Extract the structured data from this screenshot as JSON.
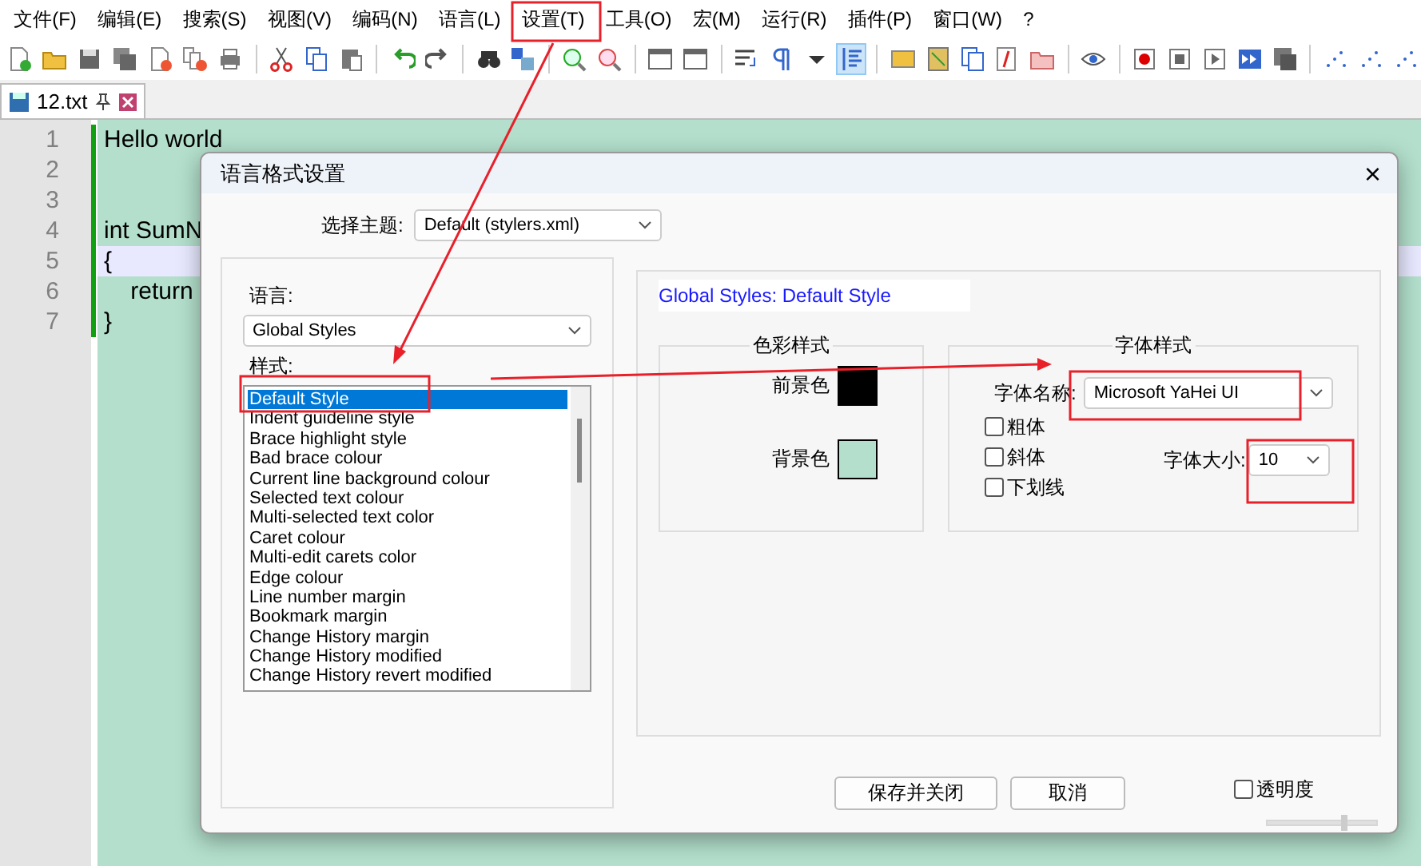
{
  "menu": [
    "文件(F)",
    "编辑(E)",
    "搜索(S)",
    "视图(V)",
    "编码(N)",
    "语言(L)",
    "设置(T)",
    "工具(O)",
    "宏(M)",
    "运行(R)",
    "插件(P)",
    "窗口(W)",
    "?"
  ],
  "tabs": [
    {
      "label": "12.txt",
      "selected": true
    }
  ],
  "editor": {
    "lines": [
      {
        "number": "1",
        "text": "Hello world",
        "current": false
      },
      {
        "number": "2",
        "current": false
      },
      {
        "number": "3",
        "current": false
      },
      {
        "number": "4",
        "text": "int SumN",
        "current": false
      },
      {
        "number": "5",
        "text": "{",
        "current": true
      },
      {
        "number": "6",
        "text": "    return",
        "current": false
      },
      {
        "number": "7",
        "text": "}",
        "current": false
      }
    ]
  },
  "dialog": {
    "title": "语言格式设置",
    "close": "×",
    "theme": {
      "label": "选择主题:",
      "value": "Default (stylers.xml)"
    },
    "language": {
      "label": "语言:",
      "value": "Global Styles"
    },
    "styles": {
      "label": "样式:",
      "items": [
        {
          "label": "Default Style",
          "selected": true
        },
        {
          "label": "Indent guideline style",
          "selected": false
        },
        {
          "label": "Brace highlight style",
          "selected": false
        },
        {
          "label": "Bad brace colour",
          "selected": false
        },
        {
          "label": "Current line background colour",
          "selected": false
        },
        {
          "label": "Selected text colour",
          "selected": false
        },
        {
          "label": "Multi-selected text color",
          "selected": false
        },
        {
          "label": "Caret colour",
          "selected": false
        },
        {
          "label": "Multi-edit carets color",
          "selected": false
        },
        {
          "label": "Edge colour",
          "selected": false
        },
        {
          "label": "Line number margin",
          "selected": false
        },
        {
          "label": "Bookmark margin",
          "selected": false
        },
        {
          "label": "Change History margin",
          "selected": false
        },
        {
          "label": "Change History modified",
          "selected": false
        },
        {
          "label": "Change History revert modified",
          "selected": false
        }
      ]
    },
    "style_title": "Global Styles: Default Style",
    "colour_group": {
      "title": "色彩样式",
      "swatches": [
        {
          "label": "前景色",
          "color": "#000000"
        },
        {
          "label": "背景色",
          "color": "#b3dfcc"
        }
      ]
    },
    "font_group": {
      "title": "字体样式",
      "name_label": "字体名称:",
      "name_value": "Microsoft YaHei UI",
      "options": [
        {
          "label": "粗体",
          "checked": false
        },
        {
          "label": "斜体",
          "checked": false
        },
        {
          "label": "下划线",
          "checked": false
        }
      ],
      "size_label": "字体大小:",
      "size_value": "10"
    },
    "buttons": [
      "保存并关闭",
      "取消"
    ],
    "transparency": {
      "label": "透明度",
      "checked": false,
      "level": 0.69
    }
  }
}
